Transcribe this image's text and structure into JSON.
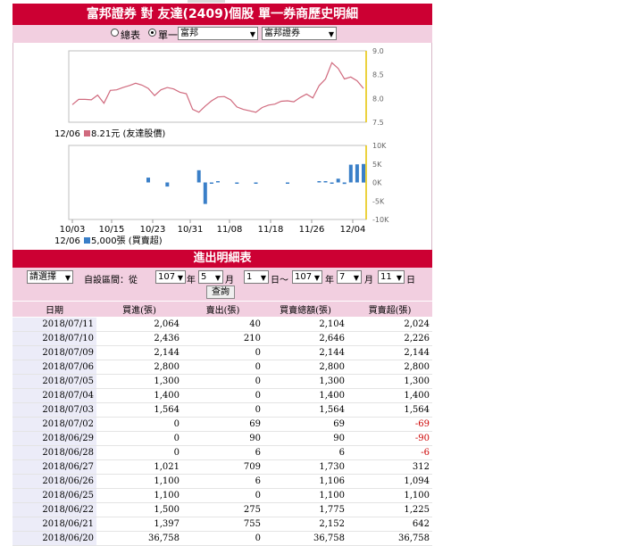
{
  "title": "富邦證券 對 友達(2409)個股 單一券商歷史明細",
  "selector": {
    "radio_all": "總表",
    "radio_single": "單一",
    "broker_group": "富邦",
    "broker_branch": "富邦證券"
  },
  "chart_data": [
    {
      "type": "line",
      "series": [
        {
          "values": [
            7.87,
            7.98,
            7.98,
            7.97,
            8.07,
            7.9,
            8.17,
            8.18,
            8.23,
            8.27,
            8.32,
            8.28,
            8.21,
            8.06,
            8.18,
            8.23,
            8.2,
            8.13,
            8.1,
            7.77,
            7.71,
            7.84,
            7.95,
            8.03,
            8.04,
            7.97,
            7.82,
            7.77,
            7.74,
            7.71,
            7.81,
            7.86,
            7.88,
            7.94,
            7.95,
            7.93,
            8.02,
            8.09,
            8.01,
            8.27,
            8.41,
            8.75,
            8.63,
            8.41,
            8.45,
            8.37,
            8.21
          ]
        }
      ],
      "y_ticks": [
        "9.0",
        "8.5",
        "8.0",
        "7.5"
      ],
      "ylim": [
        7.5,
        9.0
      ],
      "legend_date": "12/06",
      "legend_text": "8.21元 (友達股價)",
      "color": "#d06a7e"
    },
    {
      "type": "bar",
      "series": [
        {
          "values": [
            0,
            0,
            0,
            0,
            0,
            0,
            0,
            0,
            0,
            0,
            0,
            0,
            1300,
            0,
            0,
            -1100,
            0,
            0,
            0,
            0,
            3300,
            -5800,
            -300,
            300,
            0,
            0,
            -100,
            0,
            0,
            -200,
            0,
            0,
            0,
            0,
            -100,
            0,
            0,
            0,
            0,
            200,
            200,
            -200,
            1000,
            -400,
            4800,
            4900,
            5000
          ]
        }
      ],
      "y_ticks": [
        "10K",
        "5K",
        "0K",
        "-5K",
        "-10K"
      ],
      "ylim": [
        -10000,
        10000
      ],
      "x_ticks": [
        "10/03",
        "10/15",
        "10/23",
        "10/31",
        "11/08",
        "11/18",
        "11/26",
        "12/04"
      ],
      "legend_date": "12/06",
      "legend_text": "5,000張 (買賣超)",
      "color": "#3a7fc8"
    }
  ],
  "section_title": "進出明細表",
  "filter": {
    "select_label": "請選擇",
    "range_label": "自設區間：從",
    "from_year": "107",
    "from_month": "5",
    "from_day": "1",
    "to_year": "107",
    "to_month": "7",
    "to_day": "11",
    "year_unit": "年",
    "month_unit": "月",
    "day_unit": "日",
    "tilde": "日～",
    "query_button": "查詢"
  },
  "table": {
    "headers": [
      "日期",
      "買進(張)",
      "賣出(張)",
      "買賣總額(張)",
      "買賣超(張)"
    ],
    "rows": [
      [
        "2018/07/11",
        "2,064",
        "40",
        "2,104",
        "2,024"
      ],
      [
        "2018/07/10",
        "2,436",
        "210",
        "2,646",
        "2,226"
      ],
      [
        "2018/07/09",
        "2,144",
        "0",
        "2,144",
        "2,144"
      ],
      [
        "2018/07/06",
        "2,800",
        "0",
        "2,800",
        "2,800"
      ],
      [
        "2018/07/05",
        "1,300",
        "0",
        "1,300",
        "1,300"
      ],
      [
        "2018/07/04",
        "1,400",
        "0",
        "1,400",
        "1,400"
      ],
      [
        "2018/07/03",
        "1,564",
        "0",
        "1,564",
        "1,564"
      ],
      [
        "2018/07/02",
        "0",
        "69",
        "69",
        "-69"
      ],
      [
        "2018/06/29",
        "0",
        "90",
        "90",
        "-90"
      ],
      [
        "2018/06/28",
        "0",
        "6",
        "6",
        "-6"
      ],
      [
        "2018/06/27",
        "1,021",
        "709",
        "1,730",
        "312"
      ],
      [
        "2018/06/26",
        "1,100",
        "6",
        "1,106",
        "1,094"
      ],
      [
        "2018/06/25",
        "1,100",
        "0",
        "1,100",
        "1,100"
      ],
      [
        "2018/06/22",
        "1,500",
        "275",
        "1,775",
        "1,225"
      ],
      [
        "2018/06/21",
        "1,397",
        "755",
        "2,152",
        "642"
      ],
      [
        "2018/06/20",
        "36,758",
        "0",
        "36,758",
        "36,758"
      ]
    ]
  }
}
